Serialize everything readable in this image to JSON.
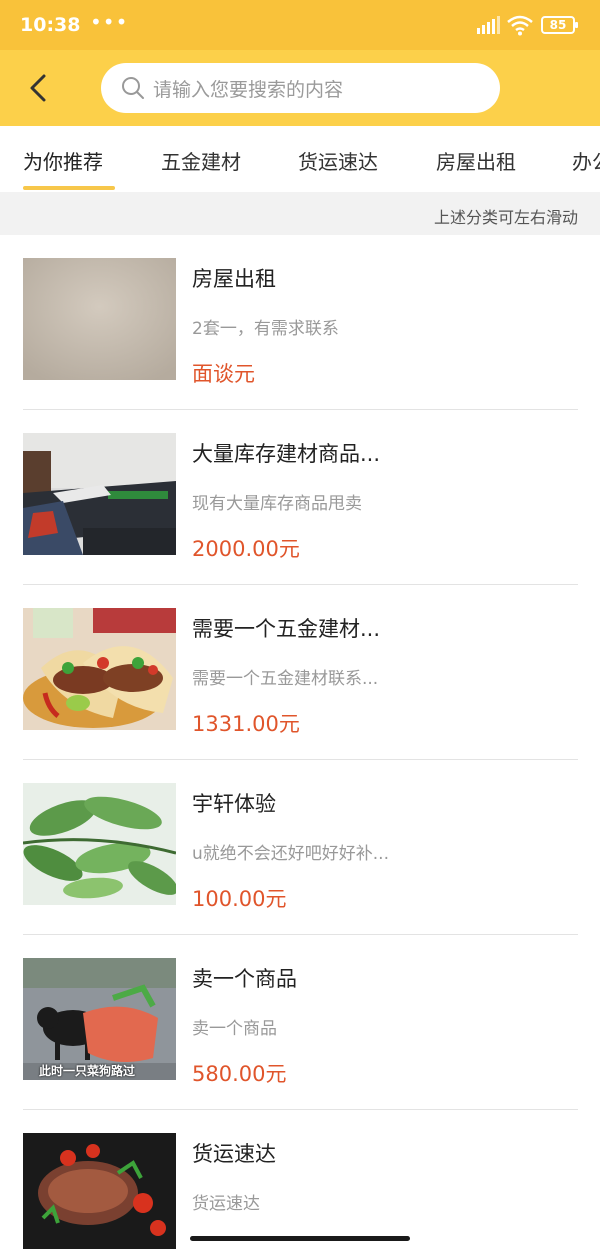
{
  "status": {
    "time": "10:38",
    "dots": "•••",
    "battery": "85"
  },
  "header": {
    "search_placeholder": "请输入您要搜索的内容"
  },
  "tabs": [
    {
      "label": "为你推荐",
      "active": true
    },
    {
      "label": "五金建材"
    },
    {
      "label": "货运速达"
    },
    {
      "label": "房屋出租"
    },
    {
      "label": "办公"
    }
  ],
  "hint": "上述分类可左右滑动",
  "listings": [
    {
      "title": "房屋出租",
      "desc": "2套一，有需求联系",
      "price": "面谈元"
    },
    {
      "title": "大量库存建材商品...",
      "desc": "现有大量库存商品甩卖",
      "price": "2000.00元"
    },
    {
      "title": "需要一个五金建材...",
      "desc": "需要一个五金建材联系...",
      "price": "1331.00元"
    },
    {
      "title": "宇轩体验",
      "desc": "u就绝不会还好吧好好补...",
      "price": "100.00元"
    },
    {
      "title": "卖一个商品",
      "desc": "卖一个商品",
      "price": "580.00元",
      "thumb_caption": "此时一只菜狗路过"
    },
    {
      "title": "货运速达",
      "desc": "货运速达",
      "price": ""
    }
  ]
}
